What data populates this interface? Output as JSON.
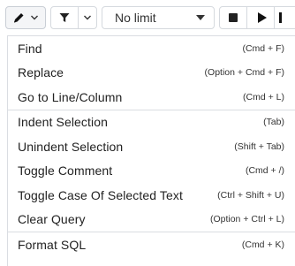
{
  "toolbar": {
    "edit_icon": "pencil-icon",
    "filter_icon": "filter-icon",
    "limit_label": "No limit",
    "stop_icon": "stop-icon",
    "run_icon": "play-icon"
  },
  "menu": {
    "groups": [
      [
        {
          "label": "Find",
          "shortcut": "(Cmd + F)"
        },
        {
          "label": "Replace",
          "shortcut": "(Option + Cmd + F)"
        },
        {
          "label": "Go to Line/Column",
          "shortcut": "(Cmd + L)"
        }
      ],
      [
        {
          "label": "Indent Selection",
          "shortcut": "(Tab)"
        },
        {
          "label": "Unindent Selection",
          "shortcut": "(Shift + Tab)"
        },
        {
          "label": "Toggle Comment",
          "shortcut": "(Cmd + /)"
        },
        {
          "label": "Toggle Case Of Selected Text",
          "shortcut": "(Ctrl + Shift + U)"
        },
        {
          "label": "Clear Query",
          "shortcut": "(Option + Ctrl + L)"
        }
      ],
      [
        {
          "label": "Format SQL",
          "shortcut": "(Cmd + K)"
        }
      ]
    ]
  }
}
